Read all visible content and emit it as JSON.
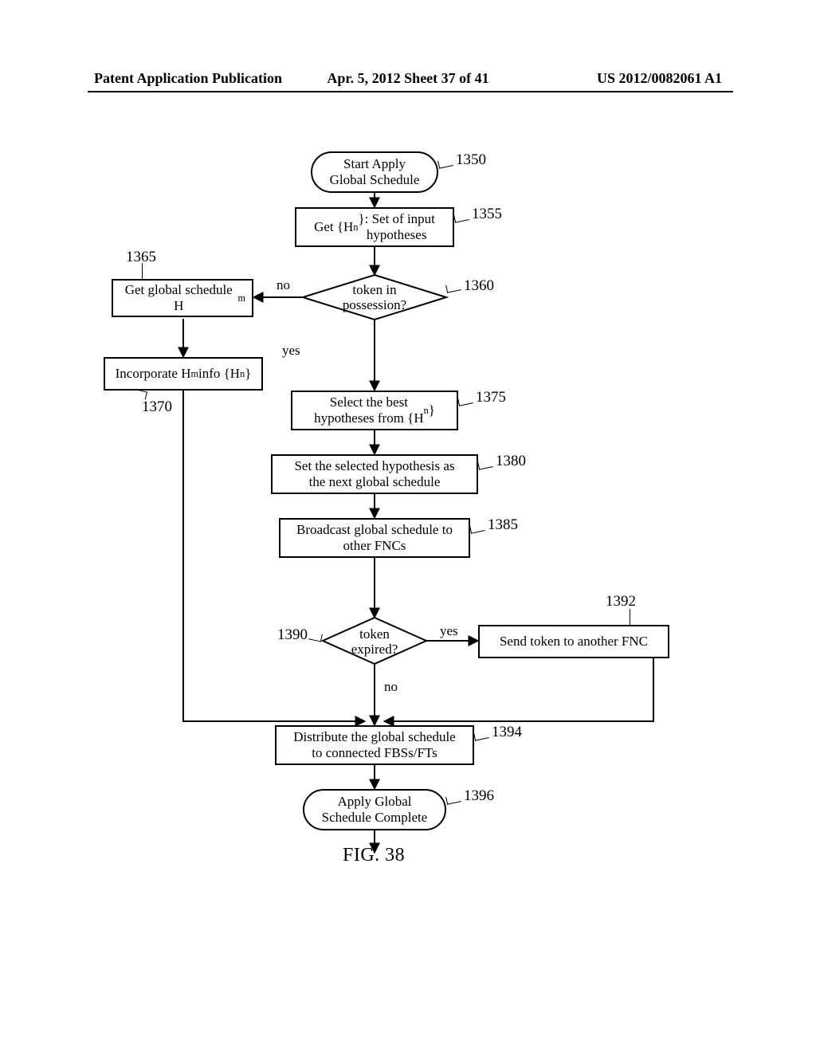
{
  "header": {
    "left": "Patent Application Publication",
    "middle": "Apr. 5, 2012  Sheet 37 of 41",
    "right": "US 2012/0082061 A1"
  },
  "figure_caption": "FIG. 38",
  "nodes": {
    "n1350": "Start Apply\nGlobal Schedule",
    "n1355": "Get {Hₙ}: Set of input\nhypotheses",
    "n1360": "token in\npossession?",
    "n1365": "Get global schedule Hₘ",
    "n1370": "Incorporate Hₘ info {Hₙ}",
    "n1375": "Select the best\nhypotheses from {Hₙ}",
    "n1380": "Set the selected hypothesis as\nthe next global schedule",
    "n1385": "Broadcast global schedule to\nother FNCs",
    "n1390": "token\nexpired?",
    "n1392": "Send token to another FNC",
    "n1394": "Distribute the global schedule\nto connected FBSs/FTs",
    "n1396": "Apply Global\nSchedule Complete"
  },
  "labels": {
    "l1360_no": "no",
    "l1360_yes": "yes",
    "l1390_yes": "yes",
    "l1390_no": "no"
  },
  "refs": {
    "r1350": "1350",
    "r1355": "1355",
    "r1360": "1360",
    "r1365": "1365",
    "r1370": "1370",
    "r1375": "1375",
    "r1380": "1380",
    "r1385": "1385",
    "r1390": "1390",
    "r1392": "1392",
    "r1394": "1394",
    "r1396": "1396"
  },
  "chart_data": {
    "type": "flowchart",
    "nodes": [
      {
        "id": 1350,
        "kind": "terminator",
        "text": "Start Apply Global Schedule"
      },
      {
        "id": 1355,
        "kind": "process",
        "text": "Get {H_n}: Set of input hypotheses"
      },
      {
        "id": 1360,
        "kind": "decision",
        "text": "token in possession?"
      },
      {
        "id": 1365,
        "kind": "process",
        "text": "Get global schedule H_m"
      },
      {
        "id": 1370,
        "kind": "process",
        "text": "Incorporate H_m info {H_n}"
      },
      {
        "id": 1375,
        "kind": "process",
        "text": "Select the best hypotheses from {H_n}"
      },
      {
        "id": 1380,
        "kind": "process",
        "text": "Set the selected hypothesis as the next global schedule"
      },
      {
        "id": 1385,
        "kind": "process",
        "text": "Broadcast global schedule to other FNCs"
      },
      {
        "id": 1390,
        "kind": "decision",
        "text": "token expired?"
      },
      {
        "id": 1392,
        "kind": "process",
        "text": "Send token to another FNC"
      },
      {
        "id": 1394,
        "kind": "process",
        "text": "Distribute the global schedule to connected FBSs/FTs"
      },
      {
        "id": 1396,
        "kind": "terminator",
        "text": "Apply Global Schedule Complete"
      }
    ],
    "edges": [
      {
        "from": 1350,
        "to": 1355
      },
      {
        "from": 1355,
        "to": 1360
      },
      {
        "from": 1360,
        "to": 1365,
        "label": "no"
      },
      {
        "from": 1360,
        "to": 1375,
        "label": "yes"
      },
      {
        "from": 1365,
        "to": 1370
      },
      {
        "from": 1370,
        "to": 1394
      },
      {
        "from": 1375,
        "to": 1380
      },
      {
        "from": 1380,
        "to": 1385
      },
      {
        "from": 1385,
        "to": 1390
      },
      {
        "from": 1390,
        "to": 1392,
        "label": "yes"
      },
      {
        "from": 1390,
        "to": 1394,
        "label": "no"
      },
      {
        "from": 1392,
        "to": 1394
      },
      {
        "from": 1394,
        "to": 1396
      }
    ]
  }
}
